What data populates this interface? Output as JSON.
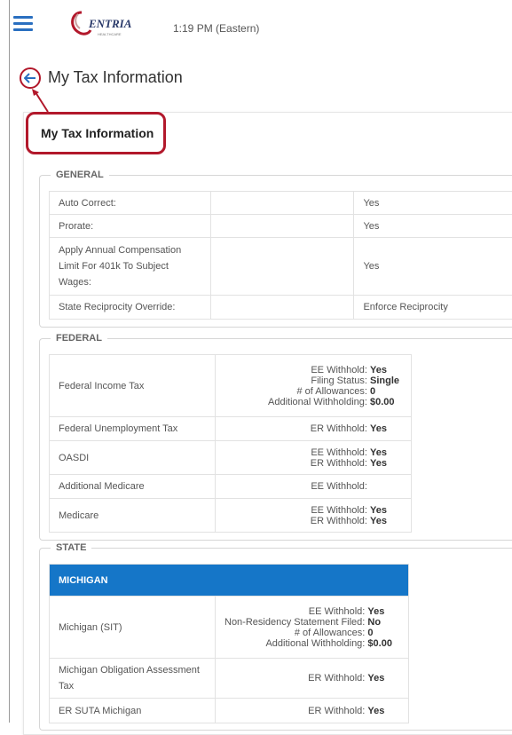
{
  "header": {
    "time": "1:19 PM (Eastern)",
    "logo_text": "CENTRIA"
  },
  "page": {
    "title": "My Tax Information",
    "card_title": "My Tax Information"
  },
  "general": {
    "legend": "GENERAL",
    "rows": [
      {
        "label": "Auto Correct:",
        "value": "Yes"
      },
      {
        "label": "Prorate:",
        "value": "Yes"
      },
      {
        "label": "Apply Annual Compensation Limit For 401k To Subject Wages:",
        "value": "Yes"
      },
      {
        "label": "State Reciprocity Override:",
        "value": "Enforce Reciprocity"
      }
    ]
  },
  "federal": {
    "legend": "FEDERAL",
    "rows": [
      {
        "label": "Federal Income Tax",
        "items": [
          {
            "k": "EE Withhold:",
            "v": "Yes"
          },
          {
            "k": "Filing Status:",
            "v": "Single"
          },
          {
            "k": "# of Allowances:",
            "v": "0"
          },
          {
            "k": "Additional Withholding:",
            "v": "$0.00"
          }
        ]
      },
      {
        "label": "Federal Unemployment Tax",
        "items": [
          {
            "k": "ER Withhold:",
            "v": "Yes"
          }
        ]
      },
      {
        "label": "OASDI",
        "items": [
          {
            "k": "EE Withhold:",
            "v": "Yes"
          },
          {
            "k": "ER Withhold:",
            "v": "Yes"
          }
        ]
      },
      {
        "label": "Additional Medicare",
        "items": [
          {
            "k": "EE Withhold:",
            "v": ""
          }
        ]
      },
      {
        "label": "Medicare",
        "items": [
          {
            "k": "EE Withhold:",
            "v": "Yes"
          },
          {
            "k": "ER Withhold:",
            "v": "Yes"
          }
        ]
      }
    ]
  },
  "state": {
    "legend": "STATE",
    "banner": "MICHIGAN",
    "rows": [
      {
        "label": "Michigan (SIT)",
        "items": [
          {
            "k": "EE Withhold:",
            "v": "Yes"
          },
          {
            "k": "Non-Residency Statement Filed:",
            "v": "No"
          },
          {
            "k": "# of Allowances:",
            "v": "0"
          },
          {
            "k": "Additional Withholding:",
            "v": "$0.00"
          }
        ]
      },
      {
        "label": "Michigan Obligation Assessment Tax",
        "items": [
          {
            "k": "ER Withhold:",
            "v": "Yes"
          }
        ]
      },
      {
        "label": "ER SUTA Michigan",
        "items": [
          {
            "k": "ER Withhold:",
            "v": "Yes"
          }
        ]
      }
    ]
  },
  "colors": {
    "accent_blue": "#1576c8",
    "highlight_red": "#b2182b"
  }
}
